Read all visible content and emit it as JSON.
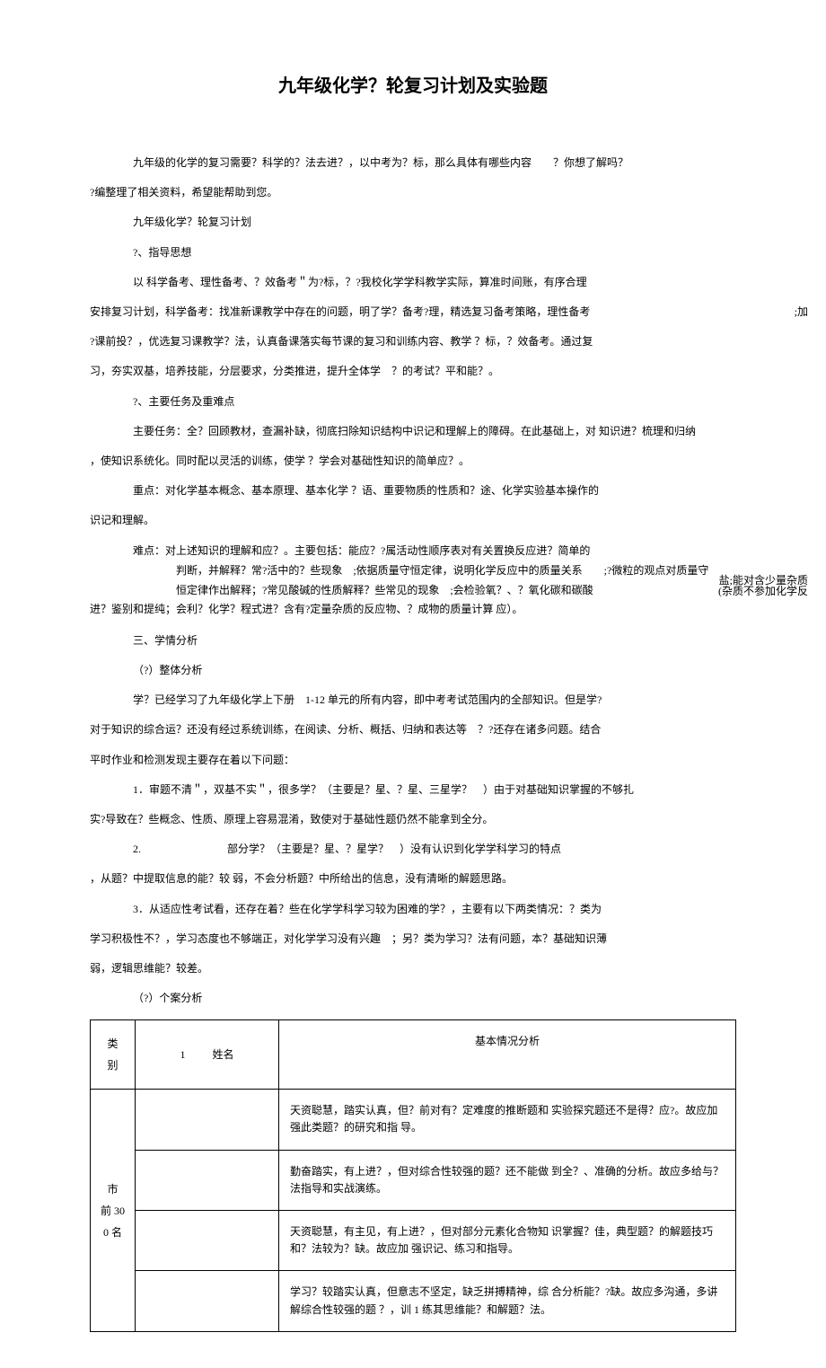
{
  "title": "九年级化学？轮复习计划及实验题",
  "p1": "九年级的化学的复习需要？科学的？法去进？，以中考为？标，那么具体有哪些内容  ？你想了解吗？",
  "p1b": "?编整理了相关资料，希望能帮助到您。",
  "p2": "九年级化学？轮复习计划",
  "p3": "?、指导思想",
  "p4a": "以 科学备考、理性备考、？效备考＂为?标，？?我校化学学科教学实际，算准时间账，有序合理",
  "p4b": "安排复习计划，科学备考：找准新课教学中存在的问题，明了学？备考?理，精选复习备考策略，理性备考",
  "p4b_right": ";加",
  "p4c": "?课前投？，优选复习课教学？法，认真备课落实每节课的复习和训练内容、教学 ？标，？效备考。通过复",
  "p4d": "习，夯实双基，培养技能，分层要求，分类推进，提升全体学 ？的考试？平和能？。",
  "p5": "?、主要任务及重难点",
  "p6a": "主要任务：全？回顾教材，查漏补缺，彻底扫除知识结构中识记和理解上的障碍。在此基础上，对 知识进？梳理和归纳",
  "p6b": "，使知识系统化。同时配以灵活的训练，使学 ？学会对基础性知识的简单应？。",
  "p7a": "重点：对化学基本概念、基本原理、基本化学 ？语、重要物质的性质和？途、化学实验基本操作的",
  "p7b": "识记和理解。",
  "p8a": "难点：对上述知识的理解和应？。主要包括：能应？?属活动性顺序表对有关置换反应进？简单的",
  "p8b": "判断，并解释？常?活中的？些现象 ;依据质量守恒定律，说明化学反应中的质量关系  ;?微粒的观点对质量守",
  "p8c": "恒定律作出解释；?常见酸碱的性质解释？些常见的现象 ;会检验氧？、？氧化碳和碳酸",
  "p8c_right": "(杂质不参加化学反",
  "p8c_right2": "盐;能对含少量杂质",
  "p8d": "进？鉴别和提纯；会利？化学？程式进？含有?定量杂质的反应物、？成物的质量计算 应）。",
  "p9": "三、学情分析",
  "p10": "（?）整体分析",
  "p11a": "学？已经学习了九年级化学上下册 1-12 单元的所有内容，即中考考试范围内的全部知识。但是学?",
  "p11b": "对于知识的综合运？还没有经过系统训练，在阅读、分析、概括、归纳和表达等 ？?还存在诸多问题。结合",
  "p11c": "平时作业和检测发现主要存在着以下问题：",
  "p12a": "1．审题不清＂，双基不实＂，很多学？（主要是？星、？星、三星学？ ）由于对基础知识掌握的不够扎",
  "p12b": "实?导致在？些概念、性质、原理上容易混淆，致使对于基础性题仍然不能拿到全分。",
  "p13a": "2.        部分学？（主要是？星、？星学？ ）没有认识到化学学科学习的特点",
  "p13b": "，从题？中提取信息的能？较 弱，不会分析题？中所给出的信息，没有清晰的解题思路。",
  "p14a": "3．从适应性考试看，还存在着？些在化学学科学习较为困难的学？，主要有以下两类情况：？类为",
  "p14b": "学习积极性不？，学习态度也不够端正，对化学学习没有兴趣 ；另？类为学习？法有问题，本？基础知识薄",
  "p14c": "弱，逻辑思维能？较差。",
  "p15": "（?）个案分析",
  "table": {
    "header": {
      "col1": "类别",
      "col1a": "类",
      "col1b": "别",
      "col2_num": "1",
      "col2": "姓名",
      "col3": "基本情况分析"
    },
    "group1_label": "市前 30 0 名",
    "group1_a": "市",
    "group1_b": "前 30",
    "group1_c": "0 名",
    "rows": [
      {
        "name": "",
        "desc": "天资聪慧，踏实认真，但？前对有？定难度的推断题和 实验探究题还不是得？应?。故应加强此类题？的研究和指 导。"
      },
      {
        "name": "",
        "desc": "勤奋踏实，有上进？，但对综合性较强的题？还不能做 到全？、准确的分析。故应多给与？法指导和实战演练。"
      },
      {
        "name": "",
        "desc": "天资聪慧，有主见，有上进？，但对部分元素化合物知 识掌握？佳，典型题？的解题技巧和？法较为？缺。故应加 强识记、练习和指导。"
      },
      {
        "name": "",
        "desc": "学习？较踏实认真，但意志不坚定，缺乏拼搏精神，综 合分析能？?缺。故应多沟通，多讲解综合性较强的题 ？，训 1 练其思维能？和解题？法。"
      }
    ]
  }
}
